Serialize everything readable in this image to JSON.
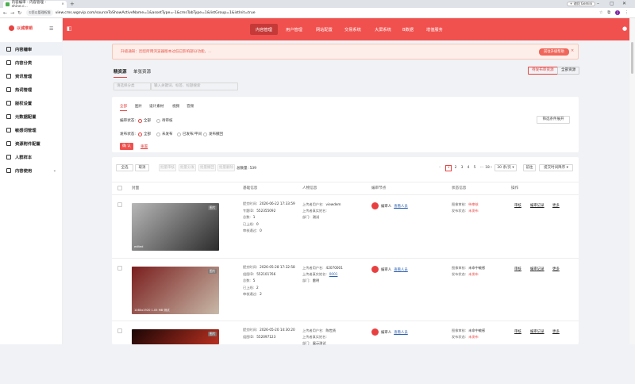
{
  "browser": {
    "tab_title": "内容编审 - 内容管理 - shine.c...",
    "url": "view.cms.wgsvip.com/sourceToShowActiveName=1&assetType=-1&cmsTabType=1&listGroup=1&istInit=true",
    "security_chip": "①您以管理权限",
    "gemini_label": "+ 询问 Gemini",
    "avatar_letter": "J"
  },
  "sidebar": {
    "logo_text": "以诚推销",
    "items": [
      {
        "label": "内容编审",
        "active": true
      },
      {
        "label": "内容分类"
      },
      {
        "label": "资讯管理"
      },
      {
        "label": "热词管理"
      },
      {
        "label": "版权设置"
      },
      {
        "label": "元数据配置"
      },
      {
        "label": "敏感词管理"
      },
      {
        "label": "资源附件配置"
      },
      {
        "label": "人群样本"
      },
      {
        "label": "内容使用"
      }
    ]
  },
  "topnav": {
    "items": [
      "内容管理",
      "用户管理",
      "网站配置",
      "交易系统",
      "大屏系统",
      "B数据",
      "增值服务"
    ]
  },
  "notice": {
    "text": "升级通知：因您所用浏览器版本过低已影响部分功能，...",
    "button": "前往升级帮助"
  },
  "tabs": {
    "items": [
      "精资源",
      "单张资源"
    ],
    "btn_upload": "待发布审资源",
    "btn_all": "全部资源"
  },
  "search": {
    "select_placeholder": "请选择分类",
    "input_placeholder": "输入关键词、标签、标题搜索"
  },
  "type_tabs": [
    "全部",
    "图片",
    "设计素材",
    "视频",
    "音频"
  ],
  "filters": {
    "edit_label": "编审状态:",
    "edit_options": [
      "全部",
      "待审核"
    ],
    "pub_label": "发布状态:",
    "pub_options": [
      "全部",
      "未发布",
      "已发布/平间",
      "发布撤回"
    ],
    "expand_btn": "筛选条件展开",
    "confirm": "确 认",
    "reset": "重置"
  },
  "toolbar": {
    "btn_select_all": "全选",
    "btn_cancel": "取消",
    "disabled_btns": [
      "批量审核",
      "批量分发",
      "批量撤回",
      "批量删除"
    ],
    "total": "总数量: 539",
    "pages": [
      "1",
      "2",
      "3",
      "4",
      "5",
      "···",
      "18"
    ],
    "page_size": "30 条/页",
    "jump": "前往",
    "sort": "提交时间降序"
  },
  "table": {
    "headers": [
      "封面",
      "基础信息",
      "人物信息",
      "编审节点",
      "状态信息",
      "操作"
    ],
    "rows": [
      {
        "image_tag": "图片",
        "caption": "edited",
        "image_colors": [
          "#b7b7b7",
          "#2b2b2b"
        ],
        "basic": [
          {
            "k": "提交时间:",
            "v": "2026-06-22 17:33:59"
          },
          {
            "k": "专题ID:",
            "v": "552355092"
          },
          {
            "k": "总数:",
            "v": "1"
          },
          {
            "k": "已上线:",
            "v": "0"
          },
          {
            "k": "审核通过:",
            "v": "0"
          }
        ],
        "person": [
          {
            "k": "上传者用户名:",
            "v": "viewdem"
          },
          {
            "k": "上传者真实姓名:",
            "v": ""
          },
          {
            "k": "部门:",
            "v": "测试"
          }
        ],
        "node": {
          "role": "编审人",
          "link": "查看人员"
        },
        "status": [
          {
            "k": "图像审核:",
            "v": "待审核",
            "red": true
          },
          {
            "k": "发布状态:",
            "v": "未发布",
            "red": true
          }
        ],
        "ops": [
          "审核",
          "编审记录",
          "更多"
        ]
      },
      {
        "image_tag": "图片",
        "caption": "1080x1920 1.05 MB 测试",
        "image_colors": [
          "#7a1e1e",
          "#c8b9a8"
        ],
        "basic": [
          {
            "k": "提交时间:",
            "v": "2026-05-28 17:32:58"
          },
          {
            "k": "组图ID:",
            "v": "552101766"
          },
          {
            "k": "总数:",
            "v": "5"
          },
          {
            "k": "已上线:",
            "v": "2"
          },
          {
            "k": "审核通过:",
            "v": "2"
          }
        ],
        "person": [
          {
            "k": "上传者用户名:",
            "v": "42070001"
          },
          {
            "k": "上传者真实姓名:",
            "v": "0001",
            "link": true
          },
          {
            "k": "部门:",
            "v": "雷明"
          }
        ],
        "node": {
          "role": "编审人",
          "link": "查看人员"
        },
        "status": [
          {
            "k": "图像审核:",
            "v": "未命中敏感",
            "red": false
          },
          {
            "k": "发布状态:",
            "v": "未发布",
            "red": true
          }
        ],
        "ops": [
          "审核",
          "编审记录",
          "更多"
        ]
      },
      {
        "image_tag": "图片",
        "caption": "",
        "image_colors": [
          "#1a0505",
          "#b83020"
        ],
        "basic": [
          {
            "k": "提交时间:",
            "v": "2026-05-20 14:30:20"
          },
          {
            "k": "组图ID:",
            "v": "552097123"
          }
        ],
        "person": [
          {
            "k": "上传者用户名:",
            "v": "陈世贤"
          },
          {
            "k": "上传者真实姓名:",
            "v": ""
          },
          {
            "k": "部门:",
            "v": "展示测试"
          }
        ],
        "node": {
          "role": "编审人",
          "link": "查看人员"
        },
        "status": [
          {
            "k": "图像审核:",
            "v": "未命中敏感",
            "red": false
          },
          {
            "k": "发布状态:",
            "v": "未发布",
            "red": true
          }
        ],
        "ops": [
          "审核",
          "编审记录",
          "更多"
        ]
      }
    ]
  },
  "colors": {
    "accent": "#f0514e",
    "link": "#2b5fb0"
  }
}
